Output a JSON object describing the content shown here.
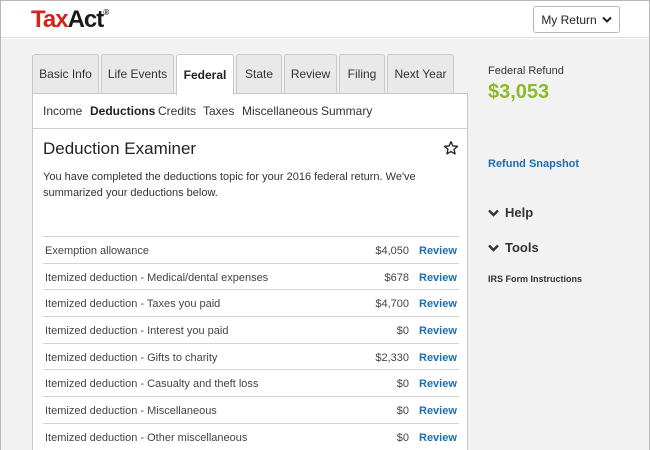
{
  "header": {
    "logo_tax": "Tax",
    "logo_act": "Act",
    "logo_mark": "®",
    "my_return_label": "My Return"
  },
  "tabs": [
    {
      "label": "Basic Info"
    },
    {
      "label": "Life Events"
    },
    {
      "label": "Federal"
    },
    {
      "label": "State"
    },
    {
      "label": "Review"
    },
    {
      "label": "Filing"
    },
    {
      "label": "Next Year"
    }
  ],
  "subnav": [
    {
      "label": "Income"
    },
    {
      "label": "Deductions"
    },
    {
      "label": "Credits"
    },
    {
      "label": "Taxes"
    },
    {
      "label": "Miscellaneous"
    },
    {
      "label": "Summary"
    }
  ],
  "panel": {
    "title": "Deduction Examiner",
    "intro": "You have completed the deductions topic for your 2016 federal return. We've summarized your deductions below."
  },
  "rows": [
    {
      "label": "Exemption allowance",
      "amount": "$4,050",
      "action": "Review"
    },
    {
      "label": "Itemized deduction - Medical/dental expenses",
      "amount": "$678",
      "action": "Review"
    },
    {
      "label": "Itemized deduction - Taxes you paid",
      "amount": "$4,700",
      "action": "Review"
    },
    {
      "label": "Itemized deduction - Interest you paid",
      "amount": "$0",
      "action": "Review"
    },
    {
      "label": "Itemized deduction - Gifts to charity",
      "amount": "$2,330",
      "action": "Review"
    },
    {
      "label": "Itemized deduction - Casualty and theft loss",
      "amount": "$0",
      "action": "Review"
    },
    {
      "label": "Itemized deduction - Miscellaneous",
      "amount": "$0",
      "action": "Review"
    },
    {
      "label": "Itemized deduction - Other miscellaneous",
      "amount": "$0",
      "action": "Review"
    }
  ],
  "sidebar": {
    "refund_label": "Federal Refund",
    "refund_amount": "$3,053",
    "snapshot_link": "Refund Snapshot",
    "help_label": "Help",
    "tools_label": "Tools",
    "irs_link": "IRS Form Instructions"
  },
  "colors": {
    "brand_red": "#d8231c",
    "link_blue": "#1b6eb3",
    "refund_green": "#8dbb25"
  }
}
